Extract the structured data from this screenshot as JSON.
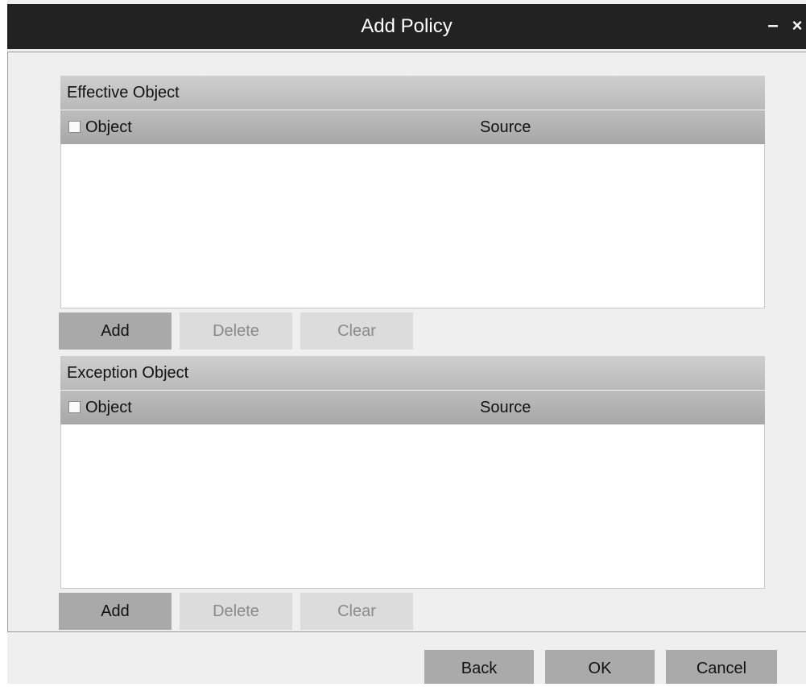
{
  "window": {
    "title": "Add Policy",
    "minimize_glyph": "–",
    "close_glyph": "×"
  },
  "effective": {
    "header": "Effective Object",
    "col_object": "Object",
    "col_source": "Source",
    "buttons": {
      "add": "Add",
      "delete": "Delete",
      "clear": "Clear"
    }
  },
  "exception": {
    "header": "Exception Object",
    "col_object": "Object",
    "col_source": "Source",
    "buttons": {
      "add": "Add",
      "delete": "Delete",
      "clear": "Clear"
    }
  },
  "footer": {
    "back": "Back",
    "ok": "OK",
    "cancel": "Cancel"
  }
}
